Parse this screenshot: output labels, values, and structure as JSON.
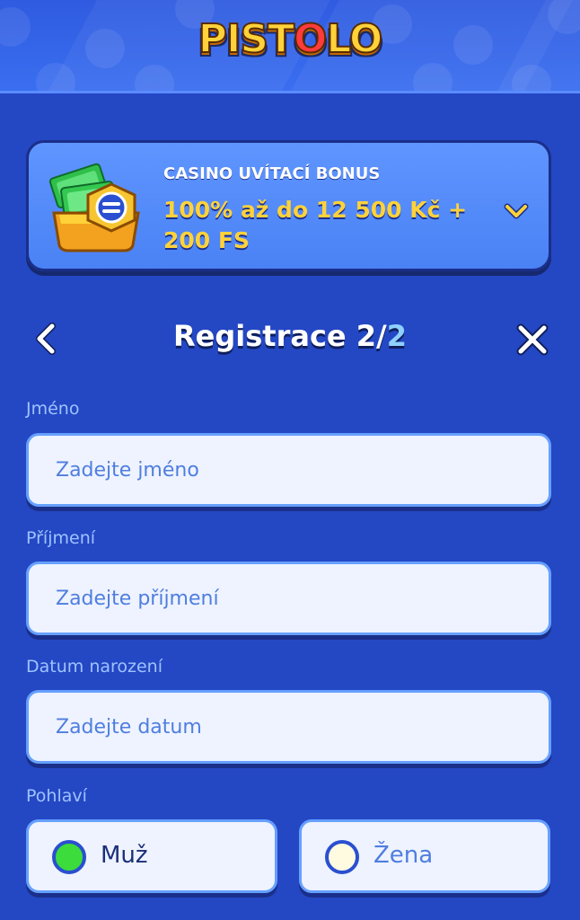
{
  "header": {
    "logo_text": "PISTOLO",
    "logo_part1": "PIST",
    "logo_part2": "O",
    "logo_part3": "LO"
  },
  "bonus": {
    "subtitle": "CASINO UVÍTACÍ BONUS",
    "title": "100% až do 12 500 Kč + 200 FS"
  },
  "nav": {
    "title_prefix": "Registrace 2/",
    "title_total": "2"
  },
  "form": {
    "first_name": {
      "label": "Jméno",
      "placeholder": "Zadejte jméno"
    },
    "last_name": {
      "label": "Příjmení",
      "placeholder": "Zadejte příjmení"
    },
    "birth_date": {
      "label": "Datum narození",
      "placeholder": "Zadejte datum"
    },
    "gender": {
      "label": "Pohlaví",
      "male": "Muž",
      "female": "Žena",
      "selected": "male"
    }
  },
  "colors": {
    "background": "#2447c4",
    "accent_yellow": "#ffd23a",
    "field_bg": "#eef3ff",
    "label": "#9ec3ff",
    "radio_selected": "#3bdc3b"
  },
  "icons": {
    "back": "chevron-left-icon",
    "close": "close-icon",
    "expand": "chevron-down-icon",
    "bonus": "cash-chest-icon"
  }
}
